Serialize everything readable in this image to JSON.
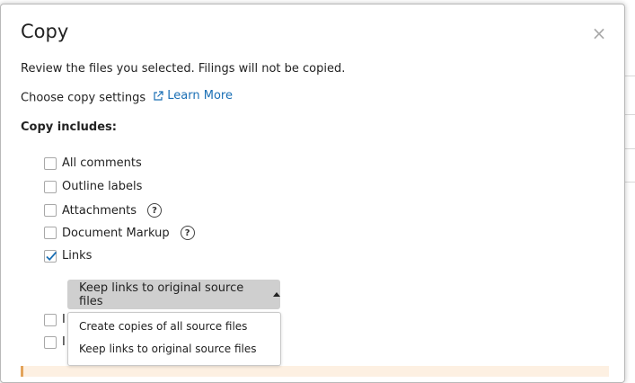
{
  "dialog": {
    "title": "Copy",
    "close_glyph": "×",
    "intro": "Review the files you selected. Filings will not be copied.",
    "settings_label": "Choose copy settings",
    "learn_more": "Learn More",
    "includes_title": "Copy includes:"
  },
  "options": [
    {
      "label": "All comments",
      "checked": false,
      "help": false
    },
    {
      "label": "Outline labels",
      "checked": false,
      "help": false
    },
    {
      "label": "Attachments",
      "checked": false,
      "help": true
    },
    {
      "label": "Document Markup",
      "checked": false,
      "help": true
    },
    {
      "label": "Links",
      "checked": true,
      "help": false
    }
  ],
  "links_select": {
    "selected": "Keep links to original source files",
    "options": [
      "Create copies of all source files",
      "Keep links to original source files"
    ]
  },
  "partially_hidden_rows": [
    {
      "label_visible": "I",
      "checked": false
    },
    {
      "label_visible": "I",
      "checked": false
    }
  ],
  "icons": {
    "external_link": "external-link-icon",
    "help": "question-circle-icon",
    "check": "checkmark-icon",
    "caret": "caret-up-icon"
  },
  "colors": {
    "link": "#1a6fb5",
    "checkmark": "#1a6fb5",
    "select_bg": "#cfcfcf",
    "warning_bg": "#fdf0e2",
    "warning_border": "#e3a35a"
  }
}
